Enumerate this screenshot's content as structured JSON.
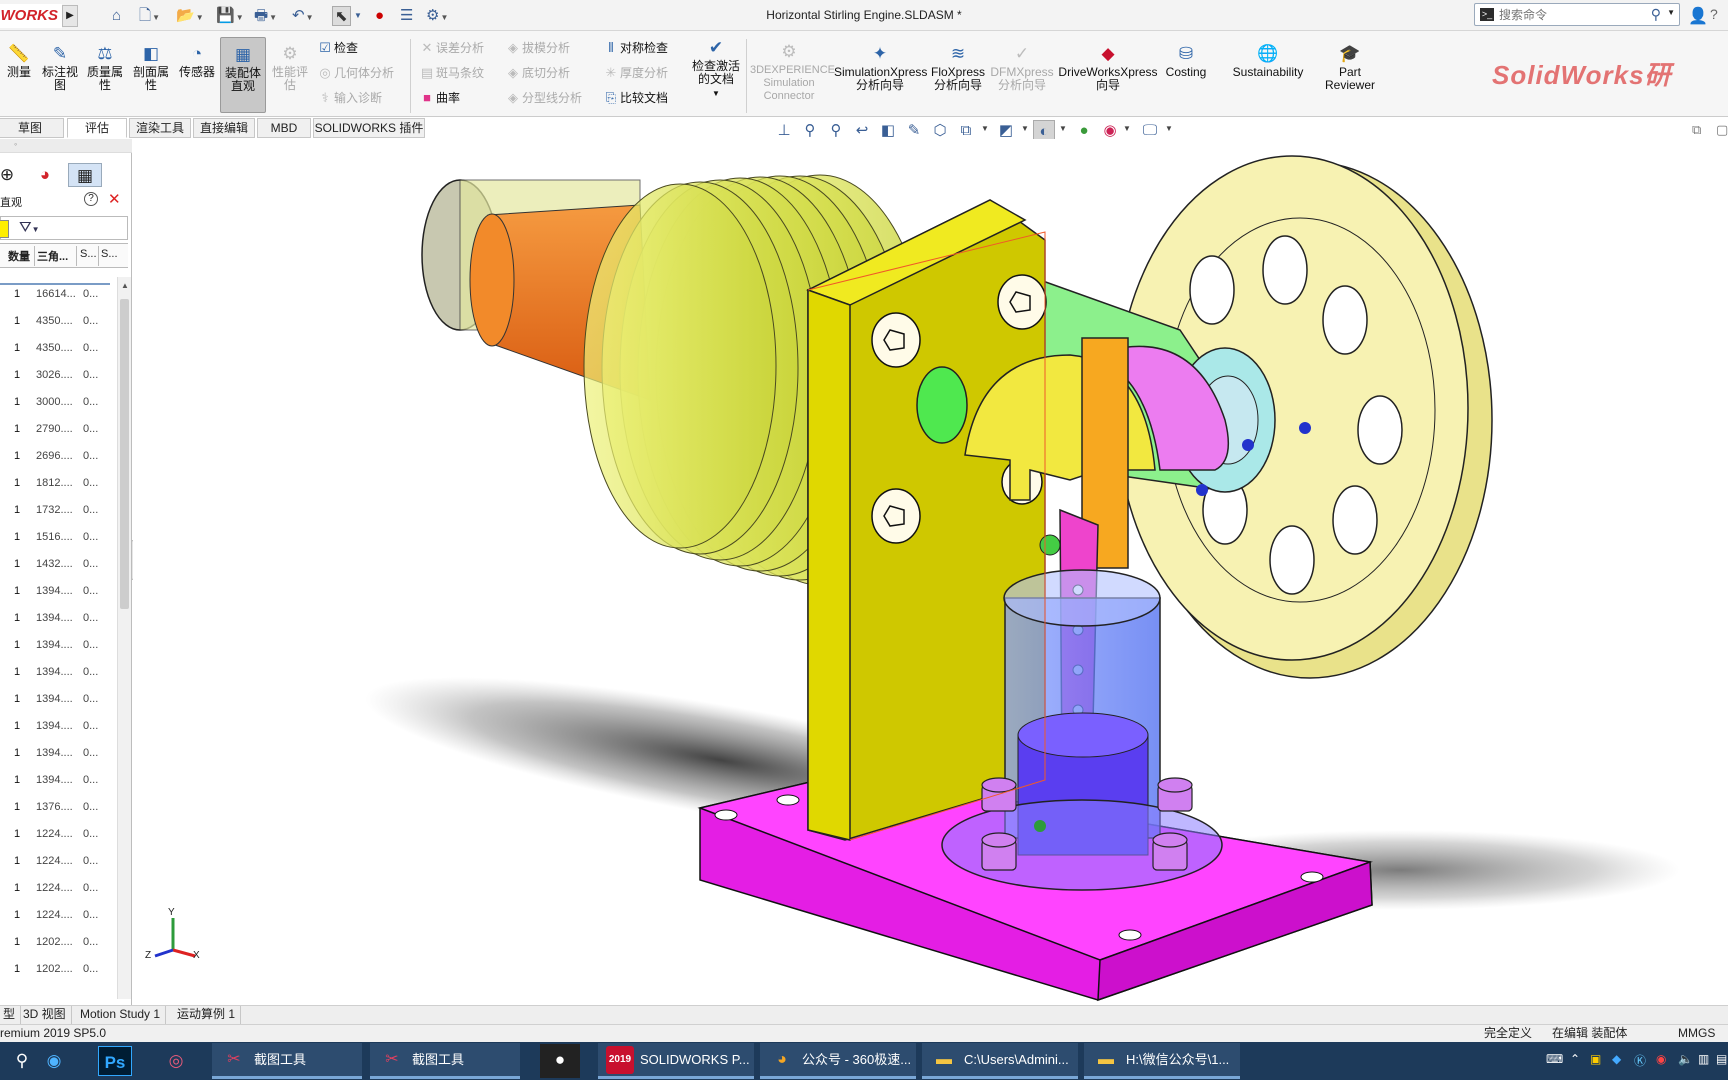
{
  "app": {
    "logo_text": "WORKS",
    "document_title": "Horizontal Stirling Engine.SLDASM *",
    "search_placeholder": "搜索命令"
  },
  "ribbon": {
    "measure": "测量",
    "markup_view": "标注视\n图",
    "mass_props": "质量属\n性",
    "section_props": "剖面属\n性",
    "sensor": "传感器",
    "assembly_visual": "装配体\n直观",
    "performance": "性能评\n估",
    "check": "检查",
    "geometry_analysis": "几何体分析",
    "import_diag": "输入诊断",
    "interference": "误差分析",
    "zebra": "斑马条纹",
    "curvature": "曲率",
    "draft": "拔模分析",
    "undercut": "底切分析",
    "parting_line": "分型线分析",
    "symmetry_check": "对称检查",
    "thickness": "厚度分析",
    "compare_docs": "比较文档",
    "check_active": "检查激活\n的文档",
    "experience": "3DEXPERIENCE\nSimulation\nConnector",
    "simxpress": "SimulationXpress\n分析向导",
    "floxpress": "FloXpress\n分析向导",
    "dfmxpress": "DFMXpress\n分析向导",
    "driveworks": "DriveWorksXpress\n向导",
    "costing": "Costing",
    "sustainability": "Sustainability",
    "part_reviewer": "Part\nReviewer",
    "watermark": "SolidWorks研"
  },
  "tabs": [
    {
      "label": "草图"
    },
    {
      "label": "评估"
    },
    {
      "label": "渲染工具"
    },
    {
      "label": "直接编辑"
    },
    {
      "label": "MBD"
    },
    {
      "label": "SOLIDWORKS 插件"
    }
  ],
  "left_panel": {
    "title": "直观",
    "help": "?",
    "close": "✕",
    "col_quantity": "数量",
    "col_triangles": "三角...",
    "col_s1": "S...",
    "col_s2": "S...",
    "rows": [
      {
        "qty": "1",
        "v1": "16614...",
        "v2": "0..."
      },
      {
        "qty": "1",
        "v1": "4350....",
        "v2": "0..."
      },
      {
        "qty": "1",
        "v1": "4350....",
        "v2": "0..."
      },
      {
        "qty": "1",
        "v1": "3026....",
        "v2": "0..."
      },
      {
        "qty": "1",
        "v1": "3000....",
        "v2": "0..."
      },
      {
        "qty": "1",
        "v1": "2790....",
        "v2": "0..."
      },
      {
        "qty": "1",
        "v1": "2696....",
        "v2": "0..."
      },
      {
        "qty": "1",
        "v1": "1812....",
        "v2": "0..."
      },
      {
        "qty": "1",
        "v1": "1732....",
        "v2": "0..."
      },
      {
        "qty": "1",
        "v1": "1516....",
        "v2": "0..."
      },
      {
        "qty": "1",
        "v1": "1432....",
        "v2": "0..."
      },
      {
        "qty": "1",
        "v1": "1394....",
        "v2": "0..."
      },
      {
        "qty": "1",
        "v1": "1394....",
        "v2": "0..."
      },
      {
        "qty": "1",
        "v1": "1394....",
        "v2": "0..."
      },
      {
        "qty": "1",
        "v1": "1394....",
        "v2": "0..."
      },
      {
        "qty": "1",
        "v1": "1394....",
        "v2": "0..."
      },
      {
        "qty": "1",
        "v1": "1394....",
        "v2": "0..."
      },
      {
        "qty": "1",
        "v1": "1394....",
        "v2": "0..."
      },
      {
        "qty": "1",
        "v1": "1394....",
        "v2": "0..."
      },
      {
        "qty": "1",
        "v1": "1376....",
        "v2": "0..."
      },
      {
        "qty": "1",
        "v1": "1224....",
        "v2": "0..."
      },
      {
        "qty": "1",
        "v1": "1224....",
        "v2": "0..."
      },
      {
        "qty": "1",
        "v1": "1224....",
        "v2": "0..."
      },
      {
        "qty": "1",
        "v1": "1224....",
        "v2": "0..."
      },
      {
        "qty": "1",
        "v1": "1202....",
        "v2": "0..."
      },
      {
        "qty": "1",
        "v1": "1202....",
        "v2": "0..."
      }
    ]
  },
  "triad": {
    "y": "Y",
    "x": "X",
    "z": "Z"
  },
  "bottom_tabs": [
    {
      "label": "型"
    },
    {
      "label": "3D 视图"
    },
    {
      "label": "Motion Study 1"
    },
    {
      "label": "运动算例 1"
    }
  ],
  "status": {
    "version": "remium 2019 SP5.0",
    "defined": "完全定义",
    "editing": "在编辑 装配体",
    "units": "MMGS"
  },
  "taskbar": {
    "items": [
      {
        "label": "截图工具"
      },
      {
        "label": "截图工具"
      },
      {
        "label": "SOLIDWORKS P..."
      },
      {
        "label": "公众号 - 360极速..."
      },
      {
        "label": "C:\\Users\\Admini..."
      },
      {
        "label": "H:\\微信公众号\\1..."
      }
    ],
    "sw_year": "2019",
    "ps_label": "Ps"
  },
  "colors": {
    "base_plate": "#ff22ff",
    "frame": "#e6e600",
    "flywheel": "#f5f0a0",
    "cylinder": "#5b7cff",
    "displacer": "#ff8020",
    "fins": "#ccdd33",
    "link": "#ee44cc",
    "watermark": "#e37373"
  }
}
